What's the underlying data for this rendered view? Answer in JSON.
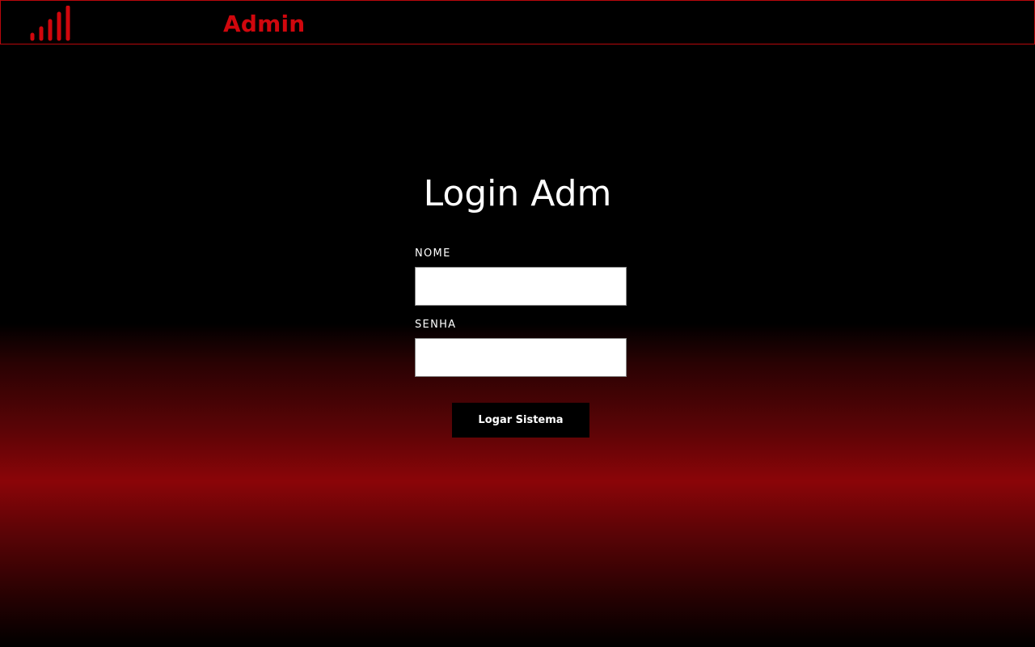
{
  "header": {
    "logo_icon": "signal-bars-icon",
    "brand_text": "Admin",
    "accent_color": "#d0070d"
  },
  "login": {
    "title": "Login Adm",
    "nome_label": "NOME",
    "nome_value": "",
    "senha_label": "SENHA",
    "senha_value": "",
    "submit_label": "Logar Sistema"
  },
  "colors": {
    "background_top": "#000000",
    "background_band": "#8b0508",
    "header_border": "#b8070c"
  }
}
